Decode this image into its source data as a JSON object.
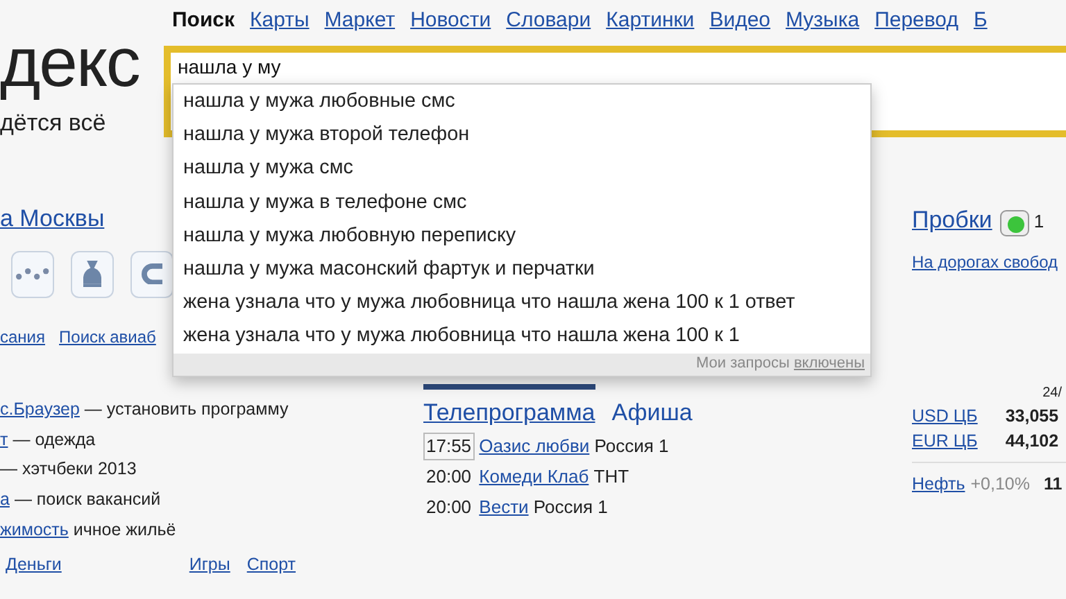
{
  "logo": {
    "text": "декс",
    "tagline": "дётся всё"
  },
  "nav": [
    {
      "label": "Поиск",
      "selected": true
    },
    {
      "label": "Карты",
      "selected": false
    },
    {
      "label": "Маркет",
      "selected": false
    },
    {
      "label": "Новости",
      "selected": false
    },
    {
      "label": "Словари",
      "selected": false
    },
    {
      "label": "Картинки",
      "selected": false
    },
    {
      "label": "Видео",
      "selected": false
    },
    {
      "label": "Музыка",
      "selected": false
    },
    {
      "label": "Перевод",
      "selected": false
    },
    {
      "label": "Б",
      "selected": false
    }
  ],
  "search": {
    "value": "нашла у му"
  },
  "suggestions": [
    "нашла у мужа любовные смс",
    "нашла у мужа второй телефон",
    "нашла у мужа смс",
    "нашла у мужа в телефоне смс",
    "нашла у мужа любовную переписку",
    "нашла у мужа масонский фартук и перчатки",
    "жена узнала что у мужа любовница что нашла жена 100 к 1 ответ",
    "жена узнала что у мужа любовница что нашла жена 100 к 1"
  ],
  "suggest_footer": {
    "text": "Мои запросы",
    "link": "включены"
  },
  "city": {
    "title": "а Москвы",
    "links": [
      "сания",
      "Поиск авиаб"
    ]
  },
  "services": [
    {
      "kind": "taxi"
    },
    {
      "kind": "money"
    },
    {
      "kind": "magnet"
    }
  ],
  "traffic": {
    "title": "Пробки",
    "score": "1",
    "color": "#3cc43c",
    "status": "На дорогах свобод"
  },
  "promo": [
    {
      "link": "с.Браузер",
      "text": "— установить программу"
    },
    {
      "link": "т",
      "text": "— одежда"
    },
    {
      "text": "— хэтчбеки 2013"
    },
    {
      "link": "а",
      "text": "— поиск вакансий"
    },
    {
      "link": "жимость",
      "text": "ичное жильё"
    }
  ],
  "bottom_links": [
    "Деньги",
    "Игры",
    "Спорт"
  ],
  "tv": {
    "tabs": [
      {
        "label": "Телепрограмма",
        "selected": true
      },
      {
        "label": "Афиша",
        "selected": false
      }
    ],
    "rows": [
      {
        "time": "17:55",
        "title": "Оазис любви",
        "channel": "Россия 1",
        "current": true
      },
      {
        "time": "20:00",
        "title": "Комеди Клаб",
        "channel": "ТНТ",
        "current": false
      },
      {
        "time": "20:00",
        "title": "Вести",
        "channel": "Россия 1",
        "current": false
      }
    ]
  },
  "rates": {
    "date": "24/",
    "rows": [
      {
        "name": "USD ЦБ",
        "value": "33,055"
      },
      {
        "name": "EUR ЦБ",
        "value": "44,102"
      }
    ],
    "oil": {
      "name": "Нефть",
      "change": "+0,10%",
      "value": "11"
    }
  }
}
